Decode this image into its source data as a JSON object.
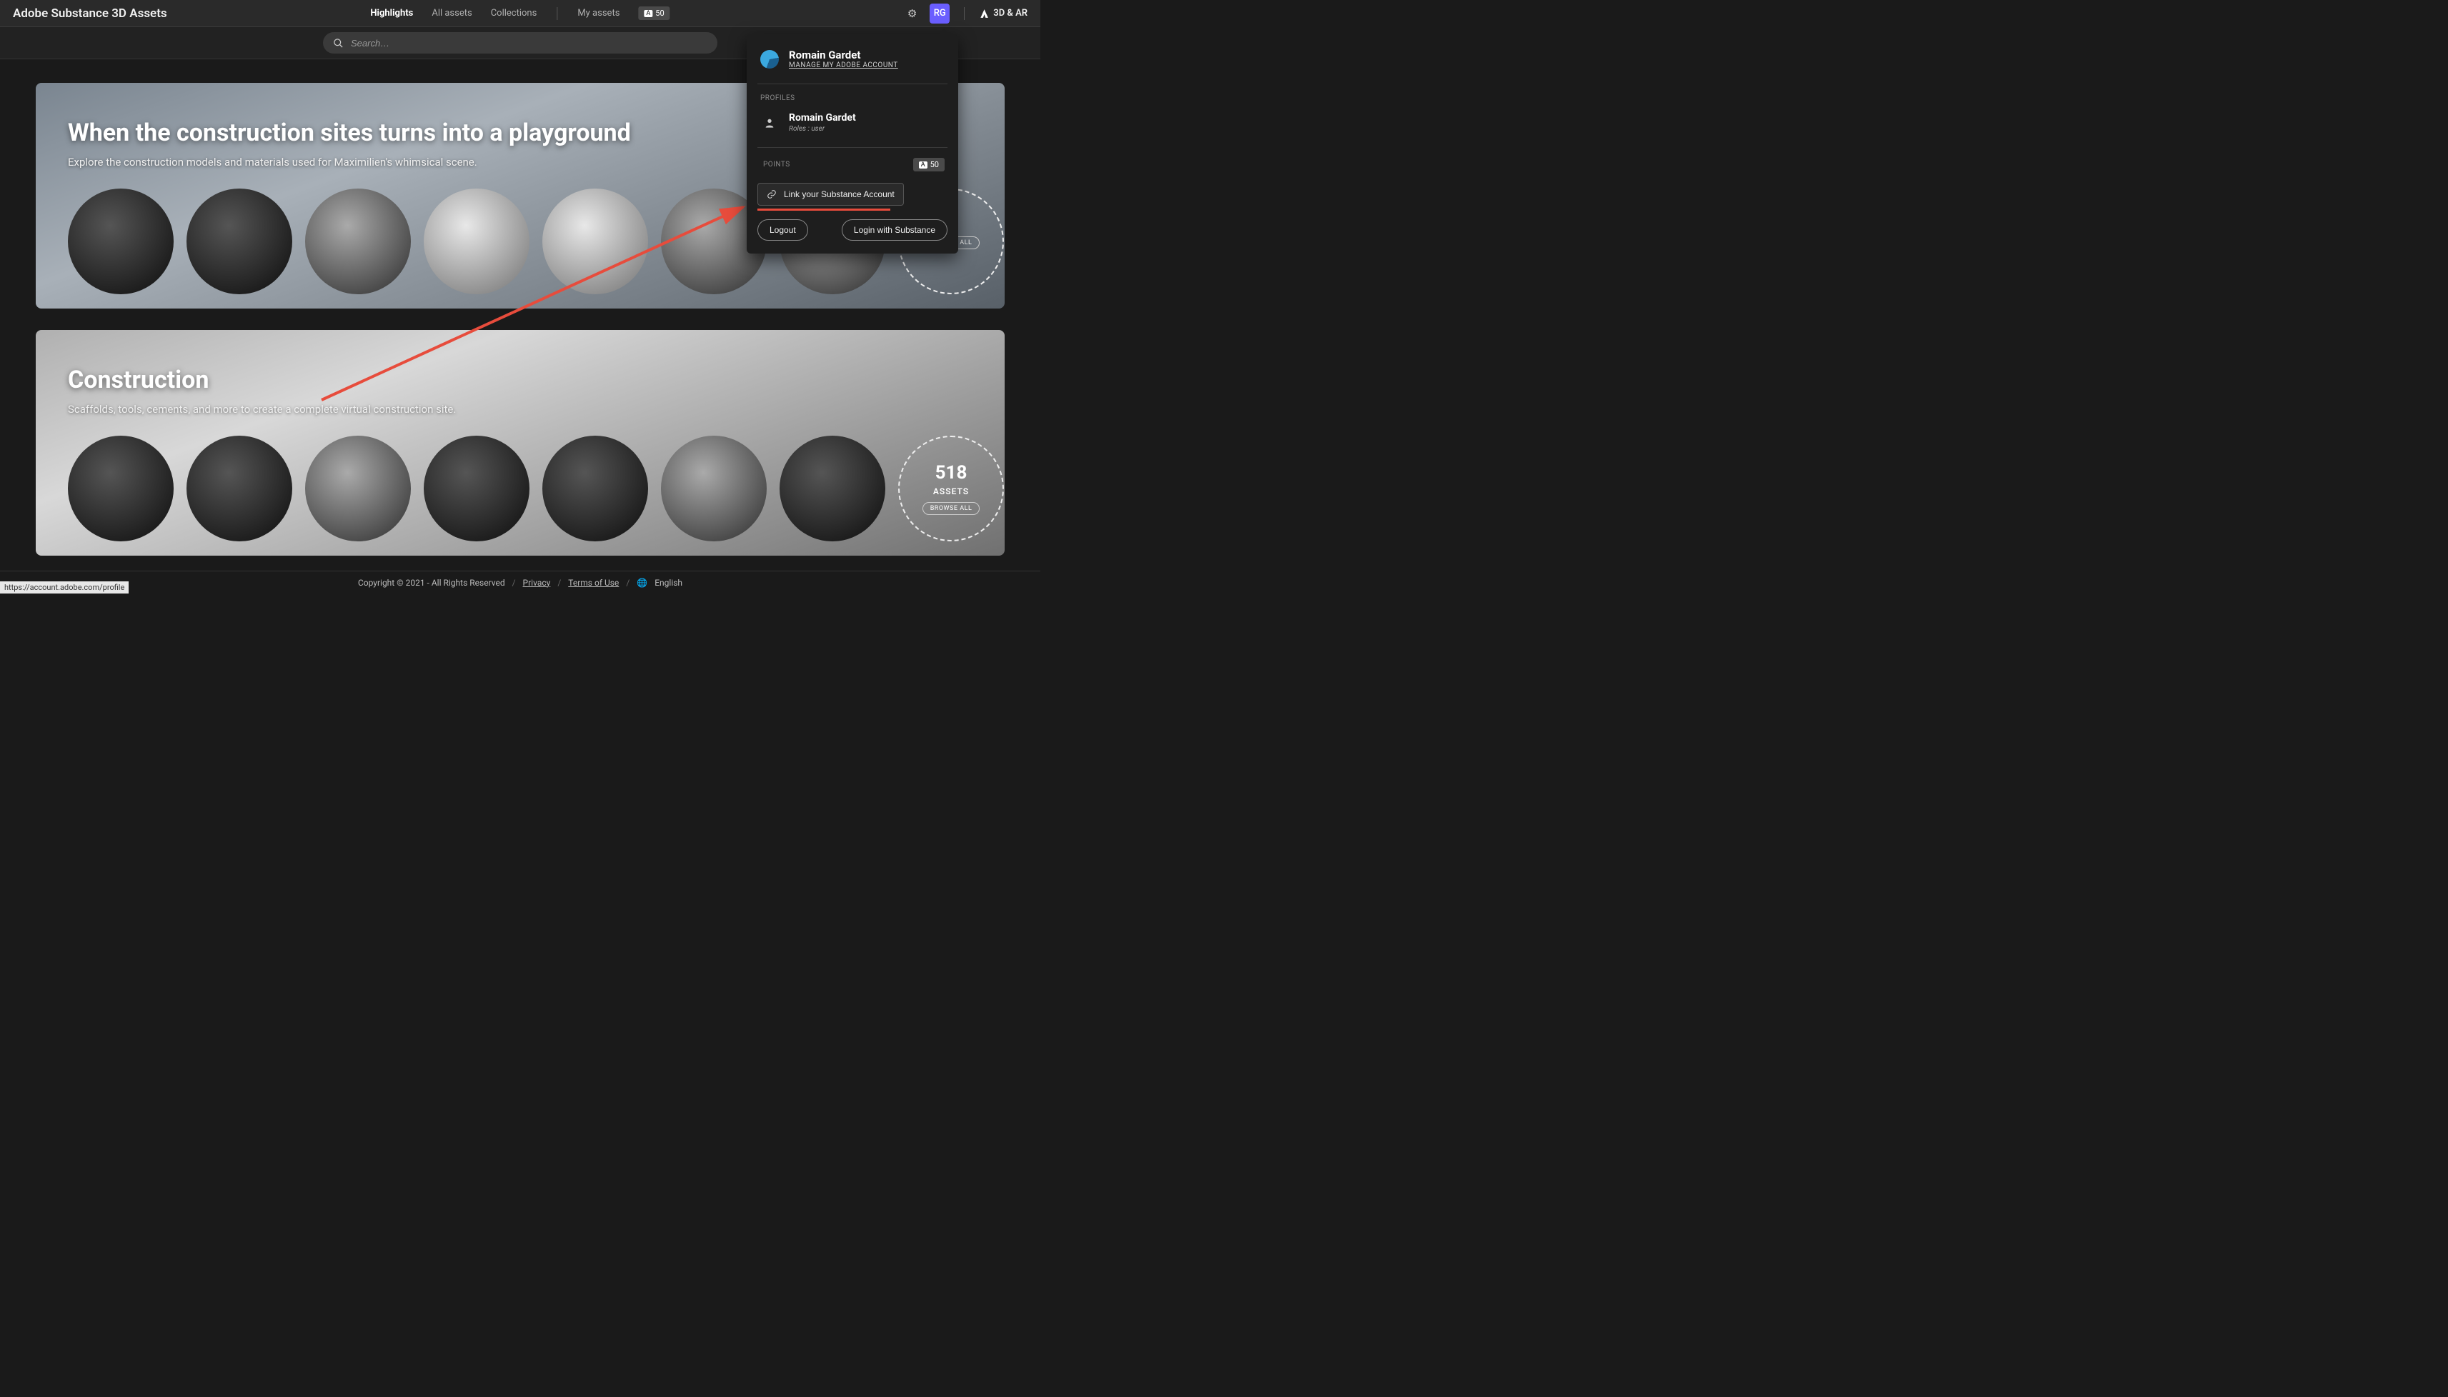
{
  "brand": {
    "title": "Adobe Substance 3D Assets",
    "right_label": "3D & AR"
  },
  "nav": {
    "highlights": "Highlights",
    "all_assets": "All assets",
    "collections": "Collections",
    "my_assets": "My assets"
  },
  "points_top": "50",
  "avatar_initials": "RG",
  "search": {
    "placeholder": "Search…"
  },
  "hero1": {
    "title": "When the construction sites turns into a playground",
    "subtitle": "Explore the construction models and materials used for Maximilien's whimsical scene.",
    "browse_label": "BROWSE ALL"
  },
  "hero2": {
    "title": "Construction",
    "subtitle": "Scaffolds, tools, cements, and more to create a complete virtual construction site.",
    "count": "518",
    "assets_label": "ASSETS",
    "browse_label": "BROWSE ALL"
  },
  "dropdown": {
    "user_name": "Romain Gardet",
    "manage_link": "MANAGE MY ADOBE ACCOUNT",
    "profiles_label": "PROFILES",
    "profile_name": "Romain Gardet",
    "profile_role": "Roles : user",
    "points_label": "POINTS",
    "points_value": "50",
    "link_account": "Link your Substance Account",
    "logout": "Logout",
    "login_substance": "Login with Substance"
  },
  "footer": {
    "copyright": "Copyright © 2021 - All Rights Reserved",
    "privacy": "Privacy",
    "terms": "Terms of Use",
    "language": "English"
  },
  "status_url": "https://account.adobe.com/profile"
}
